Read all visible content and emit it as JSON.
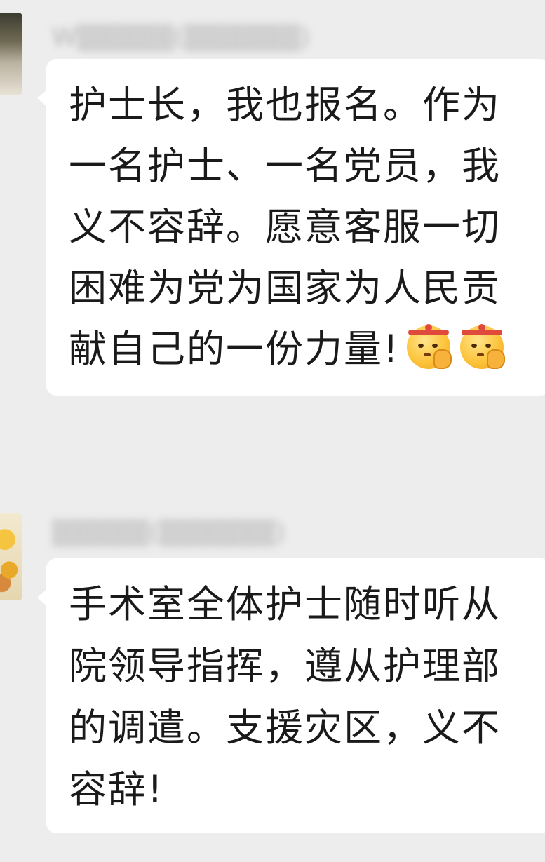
{
  "messages": [
    {
      "sender_name": "W▒▒▒▒▒(▒▒▒▒▒▒)",
      "lines": [
        "护士长，我也报名。作为",
        "一名护士、一名党员，我",
        "义不容辞。愿意客服一切",
        "困难为党为国家为人民贡",
        "献自己的一份力量!"
      ],
      "emojis": [
        "salute-headband-emoji",
        "salute-headband-emoji"
      ]
    },
    {
      "sender_name": "▒▒▒▒▒(▒▒▒▒▒▒)",
      "lines": [
        "手术室全体护士随时听从",
        "院领导指挥，遵从护理部",
        "的调遣。支援灾区，义不",
        "容辞!"
      ]
    }
  ],
  "colors": {
    "background": "#ededed",
    "bubble": "#ffffff",
    "text": "#1a1a1a"
  }
}
